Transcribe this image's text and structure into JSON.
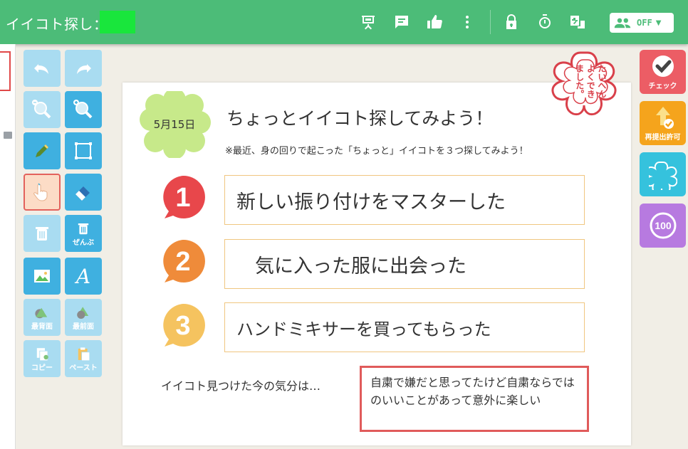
{
  "header": {
    "title": "イイコト探し：",
    "icons": [
      "presentation-icon",
      "comment-icon",
      "thumbs-up-icon",
      "more-vert-icon",
      "lock-icon",
      "timer-icon",
      "translate-icon"
    ],
    "share_toggle": {
      "label": "OFF",
      "icon": "group-icon"
    }
  },
  "tools": {
    "undo": "undo-icon",
    "redo": "redo-icon",
    "zoom_out": "zoom-out-icon",
    "zoom_in": "zoom-in-icon",
    "pen": "pen-icon",
    "select_area": "select-area-icon",
    "hand": "hand-icon",
    "eraser": "eraser-icon",
    "delete_label": "",
    "delete_all_label": "ぜんぶ",
    "image": "image-icon",
    "text": "A",
    "send_back_label": "最背面",
    "bring_front_label": "最前面",
    "copy_label": "コピー",
    "paste_label": "ペースト"
  },
  "card": {
    "date": "5月15日",
    "title": "ちょっとイイコト探してみよう！",
    "subtitle": "※最近、身の回りで起こった「ちょっと」イイコトを３つ探してみよう！",
    "items": [
      {
        "number": "1",
        "text": "新しい振り付けをマスターした",
        "color": "#e8474b"
      },
      {
        "number": "2",
        "text": "気に入った服に出会った",
        "color": "#ef8b3a"
      },
      {
        "number": "3",
        "text": "ハンドミキサーを買ってもらった",
        "color": "#f5c35f"
      }
    ],
    "mood_label": "イイコト見つけた今の気分は…",
    "mood_text": "自粛で嫌だと思ってたけど自粛ならではのいいことがあって意外に楽しい"
  },
  "stamp": {
    "lines": [
      "たいへん",
      "よくでき",
      "ました。"
    ],
    "color": "#d9404a"
  },
  "side_tools": {
    "check_label": "チェック",
    "resubmit_label": "再提出許可",
    "stamp_icon": "stamp-icon",
    "score_label": "100"
  },
  "colors": {
    "header_green": "#4cbc78",
    "tool_blue": "#3fb0e0",
    "tool_blue_disabled": "#a9dcf1",
    "check_red": "#ec5d65",
    "resubmit_orange": "#f5a41c",
    "stamp_cyan": "#35c2dd",
    "score_purple": "#b77ae0"
  }
}
